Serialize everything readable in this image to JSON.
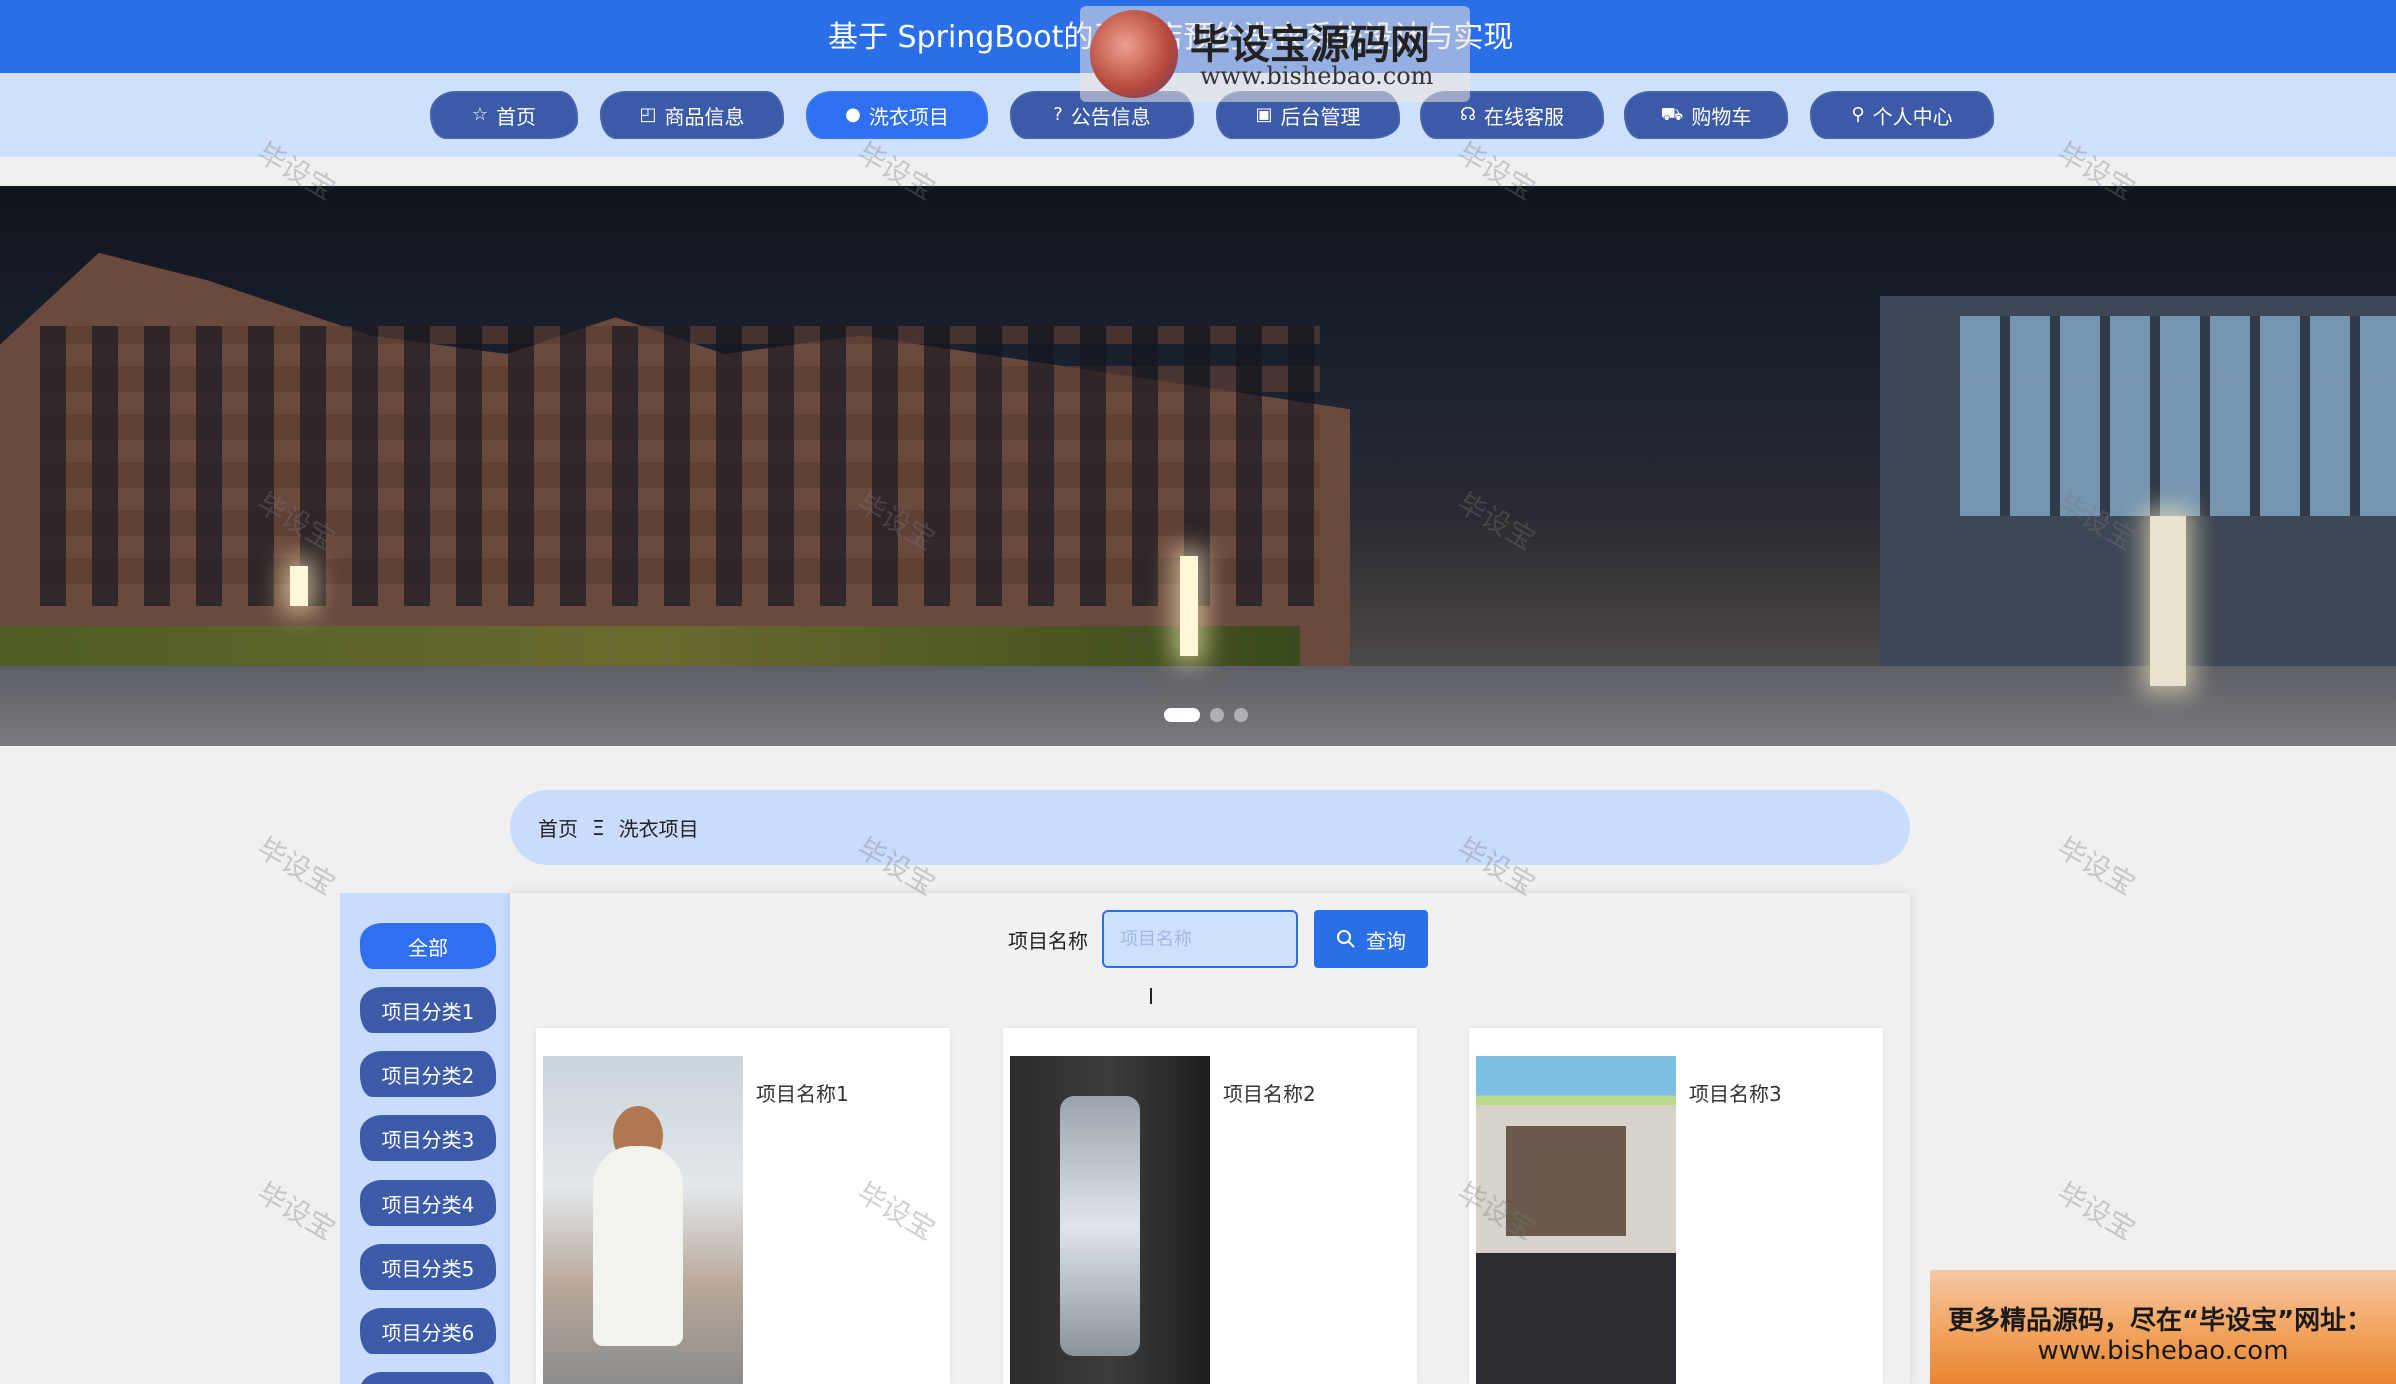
{
  "header": {
    "title": "基于 SpringBoot的干洗店预约洗衣系统设计与实现"
  },
  "watermark_logo": {
    "name": "毕设宝源码网",
    "url": "www.bishebao.com"
  },
  "nav": {
    "items": [
      {
        "label": "首页",
        "icon": "star-icon",
        "glyph": "☆"
      },
      {
        "label": "商品信息",
        "icon": "bag-icon",
        "glyph": "◰"
      },
      {
        "label": "洗衣项目",
        "icon": "info-icon",
        "glyph": "●"
      },
      {
        "label": "公告信息",
        "icon": "question-icon",
        "glyph": "?"
      },
      {
        "label": "后台管理",
        "icon": "briefcase-icon",
        "glyph": "▣"
      },
      {
        "label": "在线客服",
        "icon": "headset-icon",
        "glyph": "☊"
      },
      {
        "label": "购物车",
        "icon": "cart-icon",
        "glyph": "⛟"
      },
      {
        "label": "个人中心",
        "icon": "user-icon",
        "glyph": "⚲"
      }
    ],
    "active_index": 2
  },
  "carousel": {
    "slide_count": 3,
    "active_index": 0
  },
  "breadcrumb": {
    "home": "首页",
    "separator": "Ξ",
    "current": "洗衣项目"
  },
  "sidebar": {
    "items": [
      "全部",
      "项目分类1",
      "项目分类2",
      "项目分类3",
      "项目分类4",
      "项目分类5",
      "项目分类6"
    ],
    "active_index": 0
  },
  "search": {
    "label": "项目名称",
    "placeholder": "项目名称",
    "value": "",
    "button_label": "查询",
    "button_icon": "search-icon"
  },
  "items": [
    {
      "name": "项目名称1"
    },
    {
      "name": "项目名称2"
    },
    {
      "name": "项目名称3"
    }
  ],
  "watermark_text": "毕设宝",
  "promo": {
    "line1": "更多精品源码，尽在“毕设宝”网址：",
    "line2": "www.bishebao.com"
  },
  "colors": {
    "primary": "#2a6ee8",
    "nav_bg": "#cfe0fd",
    "button_dark": "#3b5aa8"
  }
}
